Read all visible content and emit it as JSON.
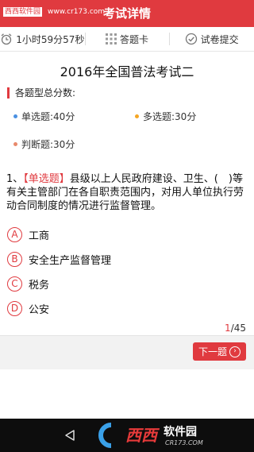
{
  "watermark": {
    "label": "西西软件园",
    "url": "www.cr173.com"
  },
  "header": {
    "title": "考试详情"
  },
  "toolbar": {
    "timer": "1小时59分57秒",
    "answer_card": "答题卡",
    "submit": "试卷提交"
  },
  "exam": {
    "title": "2016年全国普法考试二"
  },
  "summary": {
    "heading": "各题型总分数:",
    "items": [
      {
        "label": "单选题:",
        "score": "40分",
        "color": "#4a90e2"
      },
      {
        "label": "多选题:",
        "score": "30分",
        "color": "#f5a623"
      },
      {
        "label": "判断题:",
        "score": "30分",
        "color": "#e8896b"
      }
    ]
  },
  "question": {
    "number": "1、",
    "type_tag": "【单选题】",
    "text": "县级以上人民政府建设、卫生、(　)等有关主管部门在各自职责范围内，对用人单位执行劳动合同制度的情况进行监督管理。",
    "options": [
      {
        "letter": "A",
        "text": "工商"
      },
      {
        "letter": "B",
        "text": "安全生产监督管理"
      },
      {
        "letter": "C",
        "text": "税务"
      },
      {
        "letter": "D",
        "text": "公安"
      }
    ]
  },
  "pager": {
    "current": "1",
    "total": "/45"
  },
  "next_button": {
    "label": "下一题"
  },
  "brand": {
    "logo": "西西",
    "name": "软件园",
    "url": "CR173.COM"
  }
}
